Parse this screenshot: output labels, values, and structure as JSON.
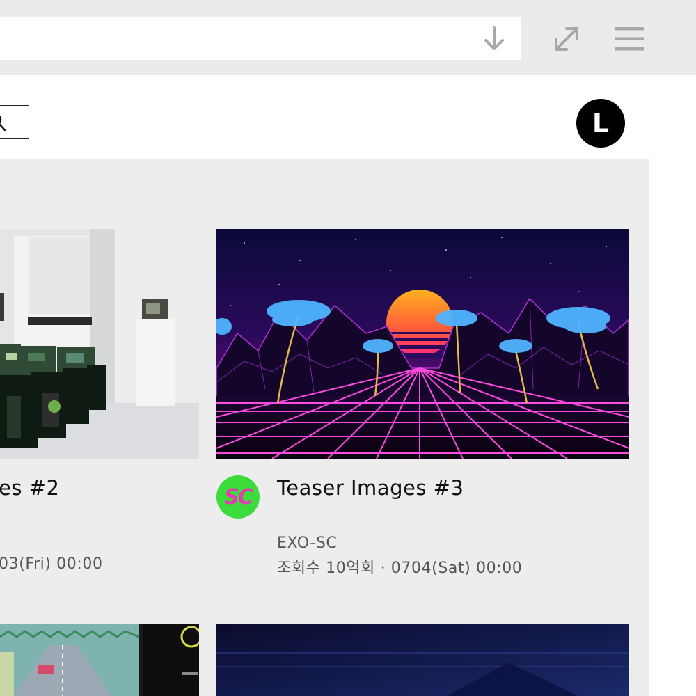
{
  "browser": {
    "download_icon": "arrow-down-icon",
    "expand_icon": "expand-arrows-icon",
    "menu_icon": "hamburger-menu-icon"
  },
  "header": {
    "search_icon": "search-icon",
    "profile_initial": "L"
  },
  "cards": [
    {
      "title": "es #2",
      "date_line": "03(Fri) 00:00"
    },
    {
      "title": "Teaser Images #3",
      "channel": "EXO-SC",
      "channel_avatar_text": "SC",
      "stats_line": "조회수 10억회 · 0704(Sat) 00:00"
    },
    {},
    {}
  ],
  "colors": {
    "chrome_bg": "#ebebeb",
    "panel_bg": "#ededed",
    "icon_gray": "#a8a8a8",
    "channel_green": "#3ddc3d",
    "channel_pink": "#e23ab0"
  }
}
